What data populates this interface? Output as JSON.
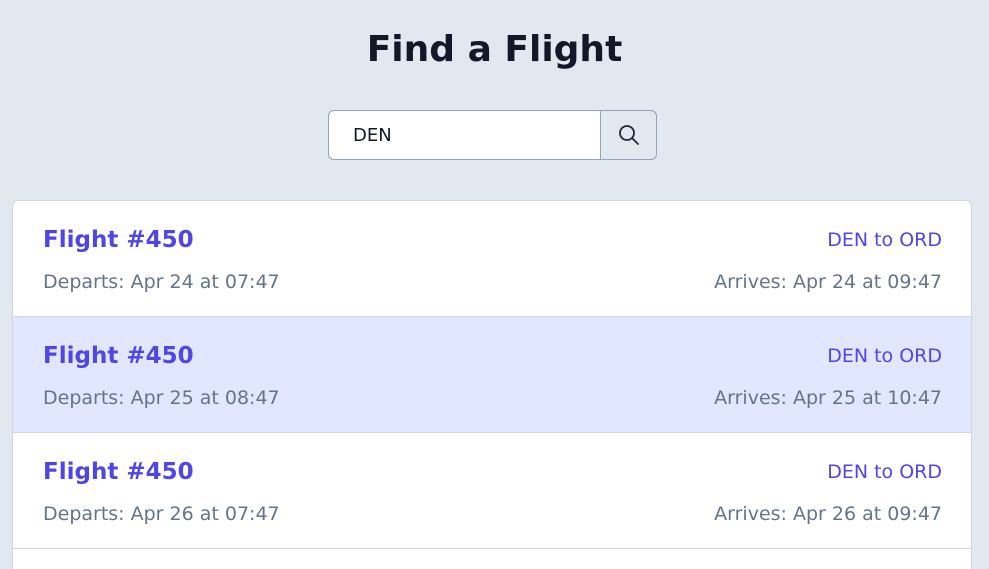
{
  "page": {
    "title": "Find a Flight"
  },
  "search": {
    "value": "DEN",
    "icon": "search-icon"
  },
  "colors": {
    "background": "#e2e8f0",
    "accent": "#4f46e5",
    "selected_row": "#e0e7ff",
    "muted_text": "#64748b"
  },
  "flights": [
    {
      "name": "Flight #450",
      "route": "DEN to ORD",
      "departs": "Departs: Apr 24 at 07:47",
      "arrives": "Arrives: Apr 24 at 09:47"
    },
    {
      "name": "Flight #450",
      "route": "DEN to ORD",
      "departs": "Departs: Apr 25 at 08:47",
      "arrives": "Arrives: Apr 25 at 10:47"
    },
    {
      "name": "Flight #450",
      "route": "DEN to ORD",
      "departs": "Departs: Apr 26 at 07:47",
      "arrives": "Arrives: Apr 26 at 09:47"
    }
  ]
}
